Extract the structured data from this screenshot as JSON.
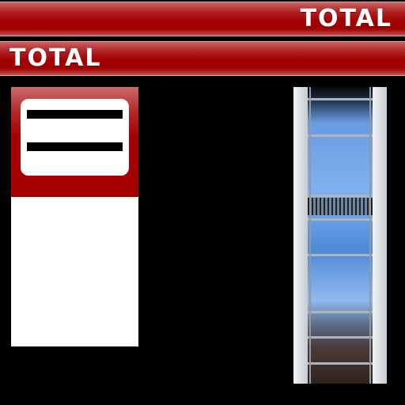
{
  "banners": {
    "top": {
      "text": "TOTAL"
    },
    "bottom": {
      "text": "TOTAL"
    }
  },
  "colors": {
    "brand_red": "#a50000",
    "white": "#ffffff",
    "background": "#000000"
  }
}
